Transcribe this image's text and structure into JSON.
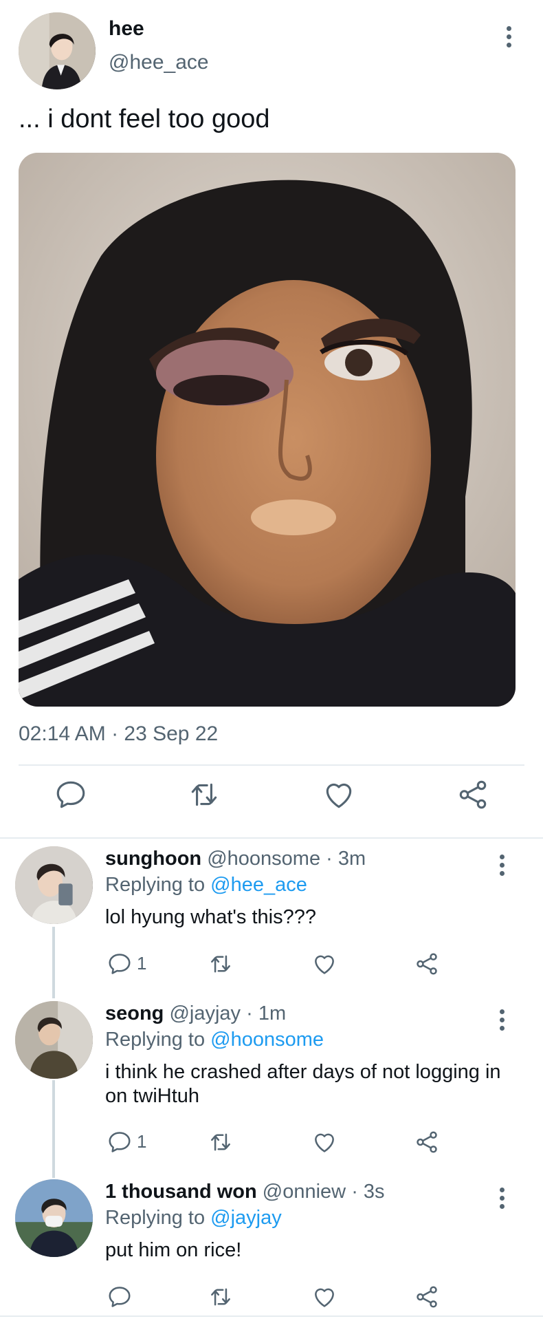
{
  "main_tweet": {
    "author_name": "hee",
    "author_handle": "@hee_ace",
    "text": "... i dont feel too good",
    "timestamp": "02:14 AM · 23 Sep 22",
    "media_alt": "photo of a person with heavy makeup",
    "actions": [
      {
        "name": "reply",
        "icon": "reply-icon"
      },
      {
        "name": "retweet",
        "icon": "retweet-icon"
      },
      {
        "name": "like",
        "icon": "heart-icon"
      },
      {
        "name": "share",
        "icon": "share-icon"
      }
    ]
  },
  "replies": [
    {
      "name": "sunghoon",
      "handle": "@hoonsome",
      "time": "· 3m",
      "replying_prefix": "Replying to",
      "replying_to": "@hee_ace",
      "text": "lol hyung what's this???",
      "reply_count": "1"
    },
    {
      "name": "seong",
      "handle": "@jayjay",
      "time": "· 1m",
      "replying_prefix": "Replying to",
      "replying_to": "@hoonsome",
      "text": "i think he crashed after days of not logging in on twiHtuh",
      "reply_count": "1"
    },
    {
      "name": "1 thousand won",
      "handle": "@onniew",
      "time": "· 3s",
      "replying_prefix": "Replying to",
      "replying_to": "@jayjay",
      "text": "put him on rice!",
      "reply_count": ""
    }
  ],
  "colors": {
    "text_primary": "#0f1419",
    "text_secondary": "#536471",
    "mention": "#1d9bf0",
    "divider": "#e6ecf0"
  }
}
